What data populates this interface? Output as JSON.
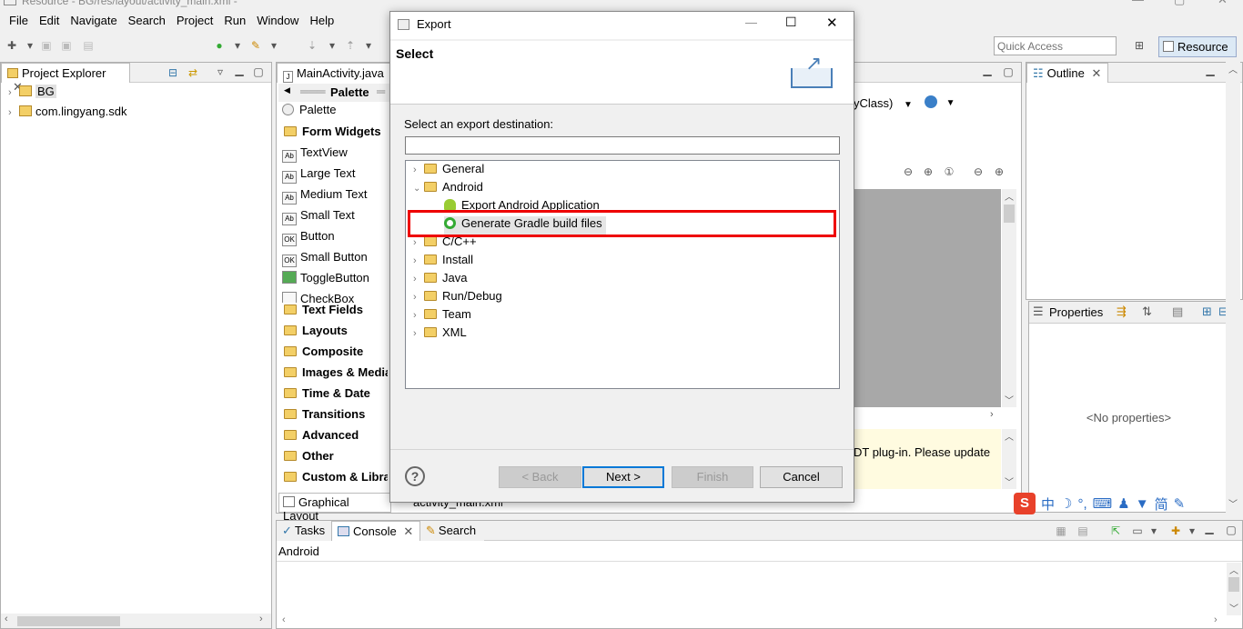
{
  "window": {
    "title": "Resource - BG/res/layout/activity_main.xml -"
  },
  "menu": [
    "File",
    "Edit",
    "Navigate",
    "Search",
    "Project",
    "Run",
    "Window",
    "Help"
  ],
  "quick_access": {
    "placeholder": "Quick Access"
  },
  "perspective": {
    "label": "Resource"
  },
  "project_explorer": {
    "tab_label": "Project Explorer",
    "items": [
      {
        "label": "BG",
        "selected": true
      },
      {
        "label": "com.lingyang.sdk",
        "selected": false
      }
    ]
  },
  "editor": {
    "tab_label": "MainActivity.java",
    "palette_header": "Palette",
    "palette_title": "Palette",
    "palette_items": [
      {
        "label": "Form Widgets",
        "kind": "category"
      },
      {
        "label": "TextView",
        "kind": "widget",
        "icon": "Ab"
      },
      {
        "label": "Large Text",
        "kind": "widget",
        "icon": "Ab"
      },
      {
        "label": "Medium Text",
        "kind": "widget",
        "icon": "Ab"
      },
      {
        "label": "Small Text",
        "kind": "widget",
        "icon": "Ab"
      },
      {
        "label": "Button",
        "kind": "widget",
        "icon": "OK"
      },
      {
        "label": "Small Button",
        "kind": "widget",
        "icon": "OK"
      },
      {
        "label": "ToggleButton",
        "kind": "widget",
        "icon": ""
      },
      {
        "label": "CheckBox",
        "kind": "widget",
        "icon": ""
      },
      {
        "label": "Text Fields",
        "kind": "category"
      },
      {
        "label": "Layouts",
        "kind": "category"
      },
      {
        "label": "Composite",
        "kind": "category"
      },
      {
        "label": "Images & Media",
        "kind": "category"
      },
      {
        "label": "Time & Date",
        "kind": "category"
      },
      {
        "label": "Transitions",
        "kind": "category"
      },
      {
        "label": "Advanced",
        "kind": "category"
      },
      {
        "label": "Other",
        "kind": "category"
      },
      {
        "label": "Custom & Library Views",
        "kind": "category"
      }
    ],
    "theme_dropdown": "yClass)",
    "warning_text": "DT plug-in. Please update",
    "bottom_tabs": [
      "Graphical Layout",
      "activity_main.xml"
    ]
  },
  "outline": {
    "tab_label": "Outline"
  },
  "properties": {
    "tab_label": "Properties",
    "empty_text": "<No properties>"
  },
  "console": {
    "tabs": [
      "Tasks",
      "Console",
      "Search"
    ],
    "active_tab": "Console",
    "content_line": "Android"
  },
  "dialog": {
    "window_title": "Export",
    "header_title": "Select",
    "prompt": "Select an export destination:",
    "filter_value": "",
    "tree": [
      {
        "label": "General",
        "expanded": false,
        "level": 0
      },
      {
        "label": "Android",
        "expanded": true,
        "level": 0
      },
      {
        "label": "Export Android Application",
        "level": 1
      },
      {
        "label": "Generate Gradle build files",
        "level": 1,
        "selected": true
      },
      {
        "label": "C/C++",
        "expanded": false,
        "level": 0
      },
      {
        "label": "Install",
        "expanded": false,
        "level": 0
      },
      {
        "label": "Java",
        "expanded": false,
        "level": 0
      },
      {
        "label": "Run/Debug",
        "expanded": false,
        "level": 0
      },
      {
        "label": "Team",
        "expanded": false,
        "level": 0
      },
      {
        "label": "XML",
        "expanded": false,
        "level": 0
      }
    ],
    "buttons": {
      "back": "< Back",
      "next": "Next >",
      "finish": "Finish",
      "cancel": "Cancel"
    },
    "help_icon": "?"
  },
  "ime_bar": {
    "items": [
      "中",
      "简"
    ]
  },
  "colors": {
    "highlight_box": "#e00000",
    "selection": "#e5e5e5",
    "accent": "#0078d7"
  }
}
